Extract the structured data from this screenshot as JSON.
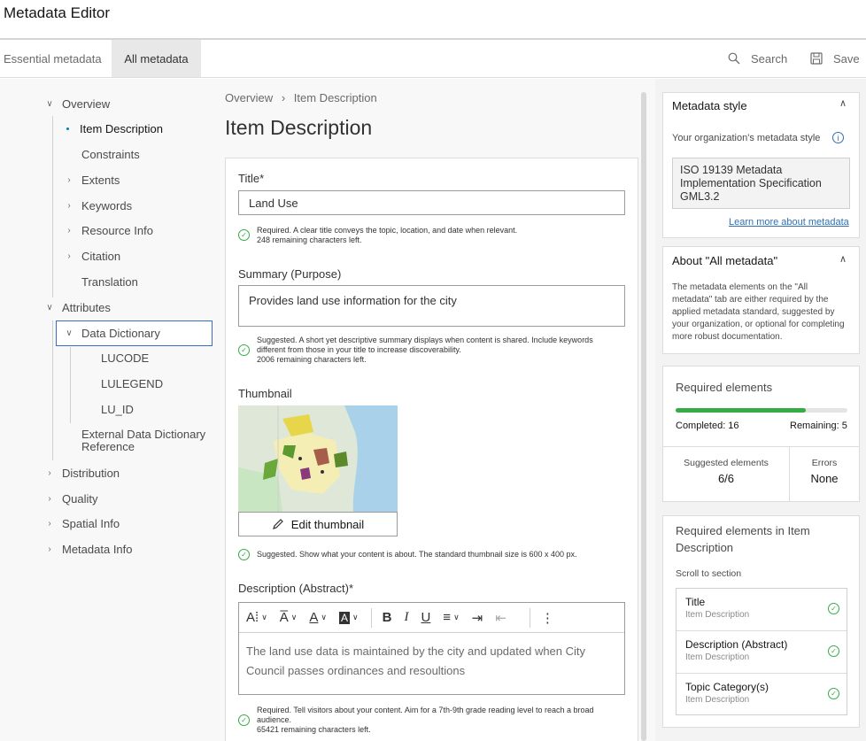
{
  "app_title": "Metadata Editor",
  "tabs": [
    "Essential metadata",
    "All metadata"
  ],
  "actions": {
    "search": "Search",
    "save": "Save"
  },
  "tree": {
    "overview": "Overview",
    "item_description": "Item Description",
    "constraints": "Constraints",
    "extents": "Extents",
    "keywords": "Keywords",
    "resource_info": "Resource Info",
    "citation": "Citation",
    "translation": "Translation",
    "attributes": "Attributes",
    "data_dictionary": "Data Dictionary",
    "lucode": "LUCODE",
    "lulegend": "LULEGEND",
    "lu_id": "LU_ID",
    "external_line1": "External Data Dictionary",
    "external_line2": "Reference",
    "distribution": "Distribution",
    "quality": "Quality",
    "spatial_info": "Spatial Info",
    "metadata_info": "Metadata Info"
  },
  "breadcrumb": {
    "parent": "Overview",
    "sep": "›",
    "current": "Item Description"
  },
  "page_title": "Item Description",
  "form": {
    "title_label": "Title*",
    "title_value": "Land Use",
    "title_hint_1": "Required. A clear title conveys the topic, location, and date when relevant.",
    "title_hint_2": "248 remaining characters left.",
    "summary_label": "Summary (Purpose)",
    "summary_value": "Provides land use information for the city",
    "summary_hint_1": "Suggested. A short yet descriptive summary displays when content is shared. Include keywords",
    "summary_hint_2": "different from those in your title to increase discoverability.",
    "summary_hint_3": "2006 remaining characters left.",
    "thumbnail_label": "Thumbnail",
    "edit_thumbnail": "Edit thumbnail",
    "thumb_hint": "Suggested. Show what your content is about. The standard thumbnail size is 600 x 400 px.",
    "description_label": "Description (Abstract)*",
    "description_value": "The land use data is maintained by the city and updated when City Council passes ordinances and resoultions",
    "desc_hint_1": "Required. Tell visitors about your content. Aim for a 7th-9th grade reading level to reach a broad",
    "desc_hint_2": "audience.",
    "desc_hint_3": "65421 remaining characters left."
  },
  "right": {
    "style_title": "Metadata style",
    "style_label": "Your organization's metadata style",
    "style_value": "ISO 19139 Metadata Implementation Specification GML3.2",
    "learn_more": "Learn more about metadata",
    "about_title": "About \"All metadata\"",
    "about_text": "The metadata elements on the \"All metadata\" tab are either required by the applied metadata standard, suggested by your organization, or optional for completing more robust documentation.",
    "required_title": "Required elements",
    "progress": 0.76,
    "completed": "Completed: 16",
    "remaining": "Remaining: 5",
    "suggested_label": "Suggested elements",
    "suggested_value": "6/6",
    "errors_label": "Errors",
    "errors_value": "None",
    "req_in_title": "Required elements in Item Description",
    "scroll_to": "Scroll to section",
    "req_items": [
      {
        "name": "Title",
        "section": "Item Description"
      },
      {
        "name": "Description (Abstract)",
        "section": "Item Description"
      },
      {
        "name": "Topic Category(s)",
        "section": "Item Description"
      }
    ]
  },
  "colors": {
    "accent": "#007ac2",
    "success": "#35ac46",
    "link": "#2f6fb3"
  }
}
